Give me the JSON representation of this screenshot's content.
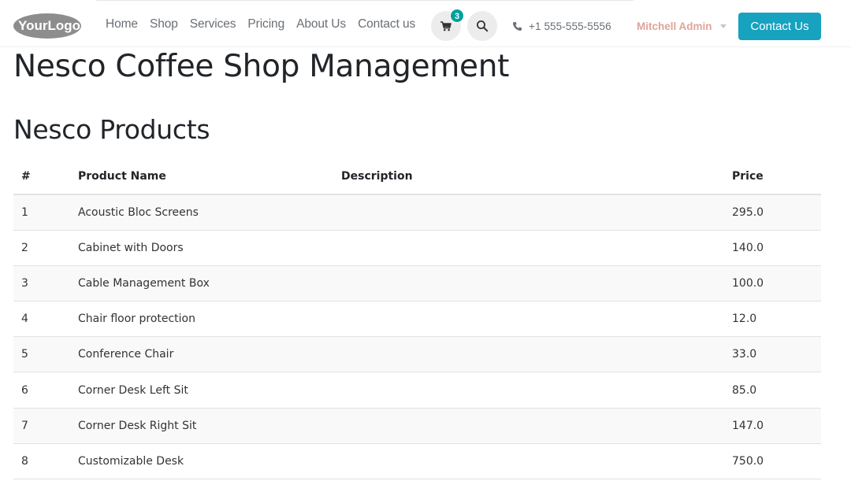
{
  "header": {
    "logo_text": "YourLogo",
    "menu": [
      "Home",
      "Shop",
      "Services",
      "Pricing",
      "About Us",
      "Contact us"
    ],
    "cart_count": "3",
    "phone": "+1 555-555-5556",
    "user_name": "Mitchell Admin",
    "cta_label": "Contact Us"
  },
  "page": {
    "title": "Nesco Coffee Shop Management",
    "subtitle": "Nesco Products"
  },
  "table": {
    "headers": [
      "#",
      "Product Name",
      "Description",
      "Price"
    ],
    "rows": [
      {
        "num": "1",
        "name": "Acoustic Bloc Screens",
        "description": "",
        "price": "295.0"
      },
      {
        "num": "2",
        "name": "Cabinet with Doors",
        "description": "",
        "price": "140.0"
      },
      {
        "num": "3",
        "name": "Cable Management Box",
        "description": "",
        "price": "100.0"
      },
      {
        "num": "4",
        "name": "Chair floor protection",
        "description": "",
        "price": "12.0"
      },
      {
        "num": "5",
        "name": "Conference Chair",
        "description": "",
        "price": "33.0"
      },
      {
        "num": "6",
        "name": "Corner Desk Left Sit",
        "description": "",
        "price": "85.0"
      },
      {
        "num": "7",
        "name": "Corner Desk Right Sit",
        "description": "",
        "price": "147.0"
      },
      {
        "num": "8",
        "name": "Customizable Desk",
        "description": "",
        "price": "750.0"
      }
    ]
  },
  "colors": {
    "accent": "#17a2c0",
    "badge": "#00a09d",
    "user_text": "#e0a39a",
    "menu_text": "#6a6f75"
  },
  "icons": [
    "cart-icon",
    "search-icon",
    "phone-icon",
    "caret-down-icon"
  ]
}
